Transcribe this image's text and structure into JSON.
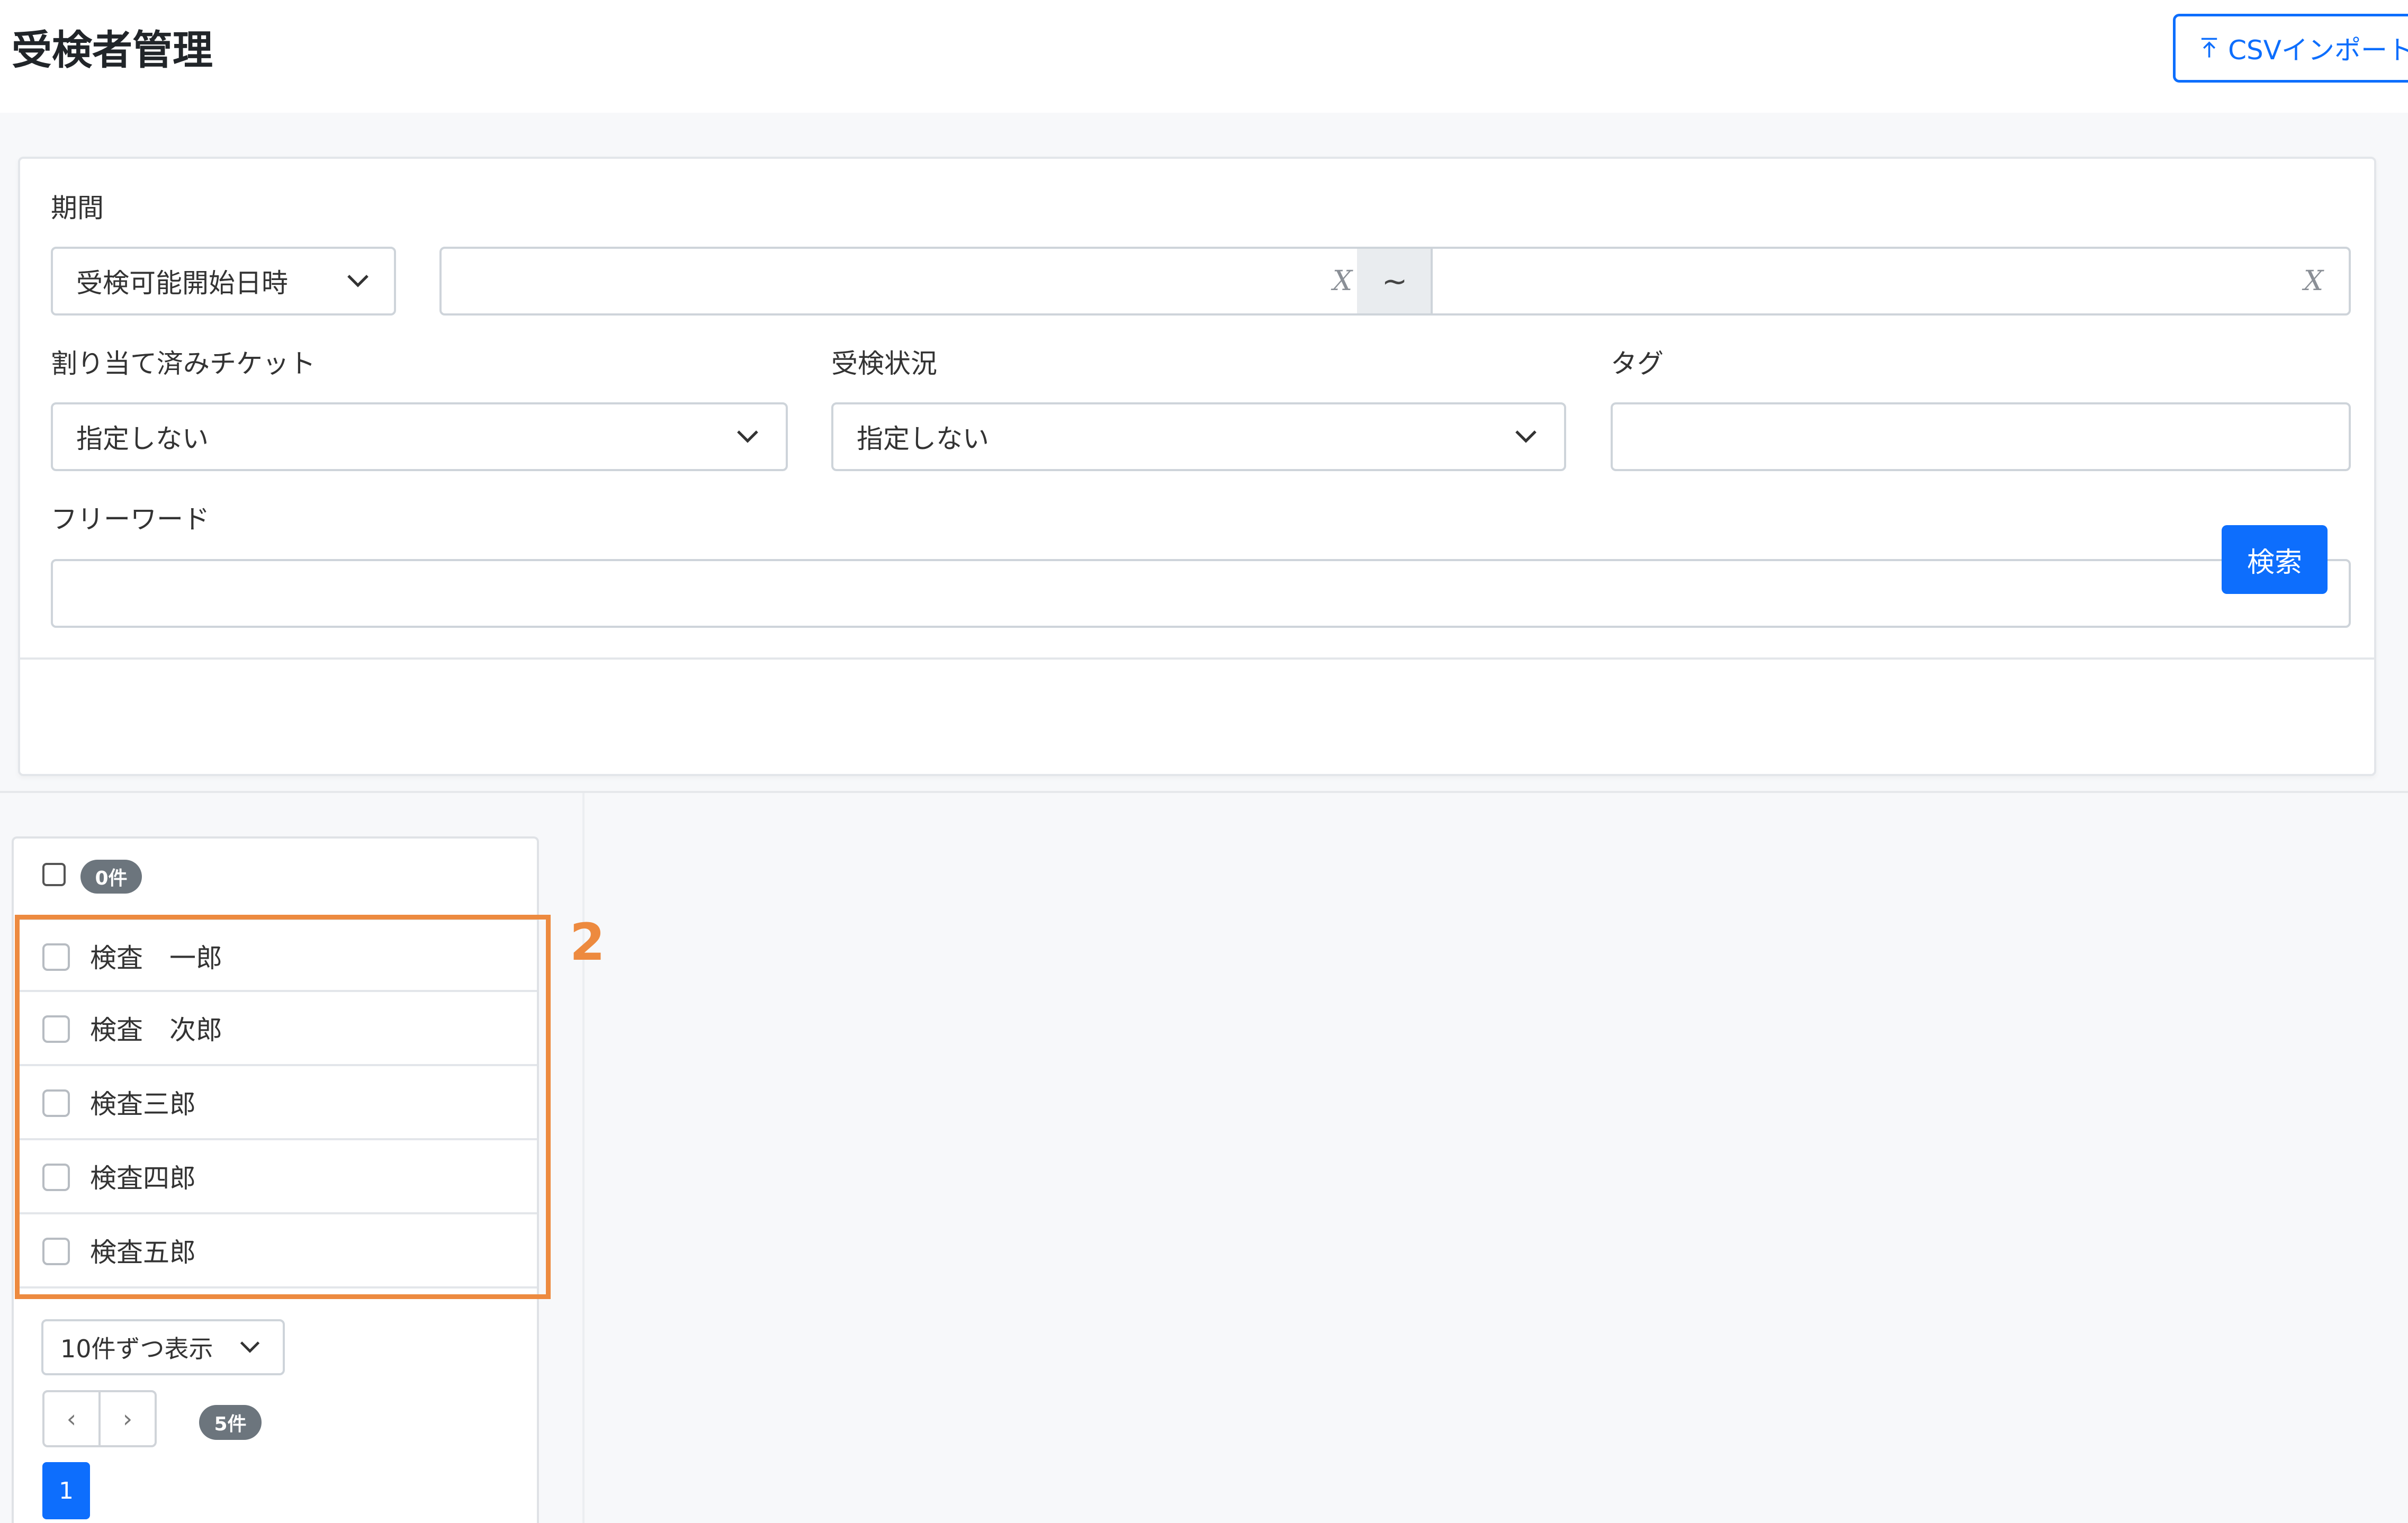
{
  "header": {
    "title": "受検者管理",
    "csv_import_label": "CSVインポート"
  },
  "search": {
    "period_label": "期間",
    "period_select_value": "受検可能開始日時",
    "date_from_value": "",
    "date_clear_glyph": "X",
    "range_separator": "~",
    "date_to_value": "",
    "ticket_label": "割り当て済みチケット",
    "ticket_value": "指定しない",
    "status_label": "受検状況",
    "status_value": "指定しない",
    "tag_label": "タグ",
    "tag_value": "",
    "freeword_label": "フリーワード",
    "freeword_value": "",
    "search_button": "検索"
  },
  "list": {
    "selected_count": "0件",
    "items": [
      {
        "name": "検査　一郎"
      },
      {
        "name": "検査　次郎"
      },
      {
        "name": "検査三郎"
      },
      {
        "name": "検査四郎"
      },
      {
        "name": "検査五郎"
      }
    ],
    "per_page_value": "10件ずつ表示",
    "prev_glyph": "‹",
    "next_glyph": "›",
    "total_count": "5件",
    "current_page": "1"
  },
  "annotation": {
    "number": "2",
    "color": "#ed8a3f"
  },
  "colors": {
    "primary": "#0d6efd",
    "badge": "#6c757d"
  }
}
